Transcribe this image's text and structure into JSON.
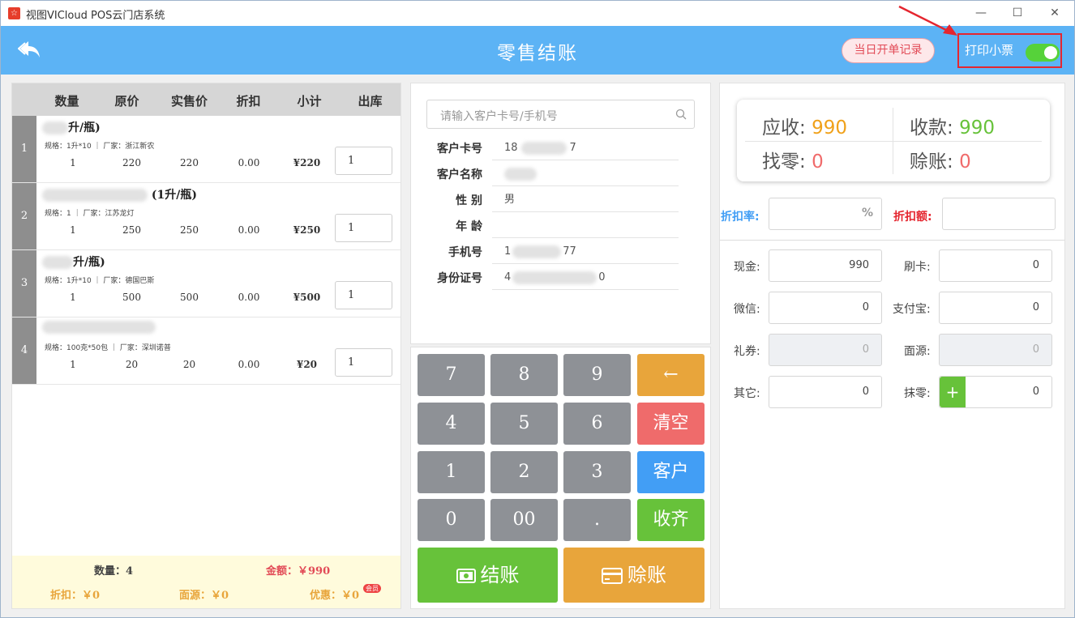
{
  "window": {
    "title": "视图VICloud POS云门店系统",
    "app_icon_glyph": "☆",
    "minimize": "—",
    "maximize": "☐",
    "close": "✕"
  },
  "header": {
    "title": "零售结账",
    "records_button": "当日开单记录",
    "print_label": "打印小票",
    "print_enabled": true,
    "bg_color": "#5cb3f5"
  },
  "table": {
    "headers": [
      "数量",
      "原价",
      "实售价",
      "折扣",
      "小计",
      "出库"
    ],
    "rows": [
      {
        "index": "1",
        "name": "升/瓶)",
        "spec": "规格：1升*10 ｜ 厂家：浙江新农",
        "qty": "1",
        "orig": "220",
        "price": "220",
        "discount": "0.00",
        "subtotal": "¥220",
        "out": "1"
      },
      {
        "index": "2",
        "name": "(1升/瓶)",
        "spec": "规格：1 ｜ 厂家：江苏龙灯",
        "qty": "1",
        "orig": "250",
        "price": "250",
        "discount": "0.00",
        "subtotal": "¥250",
        "out": "1"
      },
      {
        "index": "3",
        "name": "升/瓶)",
        "spec": "规格：1升*10 ｜ 厂家：德国巴斯",
        "qty": "1",
        "orig": "500",
        "price": "500",
        "discount": "0.00",
        "subtotal": "¥500",
        "out": "1"
      },
      {
        "index": "4",
        "name": "",
        "spec": "规格：100克*50包 ｜ 厂家：深圳诺普",
        "qty": "1",
        "orig": "20",
        "price": "20",
        "discount": "0.00",
        "subtotal": "¥20",
        "out": "1"
      }
    ]
  },
  "summary": {
    "count": "数量：4",
    "amount": "金额：￥990",
    "discount": "折扣：￥0",
    "miandan": "面源：￥0",
    "youhui": "优惠：￥0",
    "badge": "会员"
  },
  "customer": {
    "search_placeholder": "请输入客户卡号/手机号",
    "fields": [
      {
        "label": "客户卡号",
        "value": "18",
        "value_end": "7"
      },
      {
        "label": "客户名称",
        "value": "",
        "value_end": ""
      },
      {
        "label": "性 别",
        "value": "男",
        "value_end": ""
      },
      {
        "label": "年 龄",
        "value": "",
        "value_end": ""
      },
      {
        "label": "手机号",
        "value": "1",
        "value_end": "77"
      },
      {
        "label": "身份证号",
        "value": "4",
        "value_end": "0"
      }
    ]
  },
  "keypad": {
    "keys": [
      "7",
      "8",
      "9",
      "←",
      "4",
      "5",
      "6",
      "清空",
      "1",
      "2",
      "3",
      "客户",
      "0",
      "00",
      ".",
      "收齐"
    ],
    "checkout": "结账",
    "credit": "赊账"
  },
  "totals": {
    "receivable_label": "应收:",
    "receivable": "990",
    "received_label": "收款:",
    "received": "990",
    "change_label": "找零:",
    "change": "0",
    "credit_label": "赊账:",
    "credit": "0",
    "receivable_color": "#f0a11a",
    "received_color": "#67c23a",
    "zero_color": "#f06b6b"
  },
  "discount": {
    "rate_label": "折扣率:",
    "rate_suffix": "%",
    "amount_label": "折扣额:"
  },
  "payments": [
    {
      "label": "现金:",
      "value": "990",
      "disabled": false
    },
    {
      "label": "刷卡:",
      "value": "0",
      "disabled": false
    },
    {
      "label": "微信:",
      "value": "0",
      "disabled": false
    },
    {
      "label": "支付宝:",
      "value": "0",
      "disabled": false
    },
    {
      "label": "礼券:",
      "value": "0",
      "disabled": true
    },
    {
      "label": "面源:",
      "value": "0",
      "disabled": true
    },
    {
      "label": "其它:",
      "value": "0",
      "disabled": false
    },
    {
      "label": "抹零:",
      "value": "0",
      "disabled": false
    }
  ],
  "moling_plus": "+"
}
